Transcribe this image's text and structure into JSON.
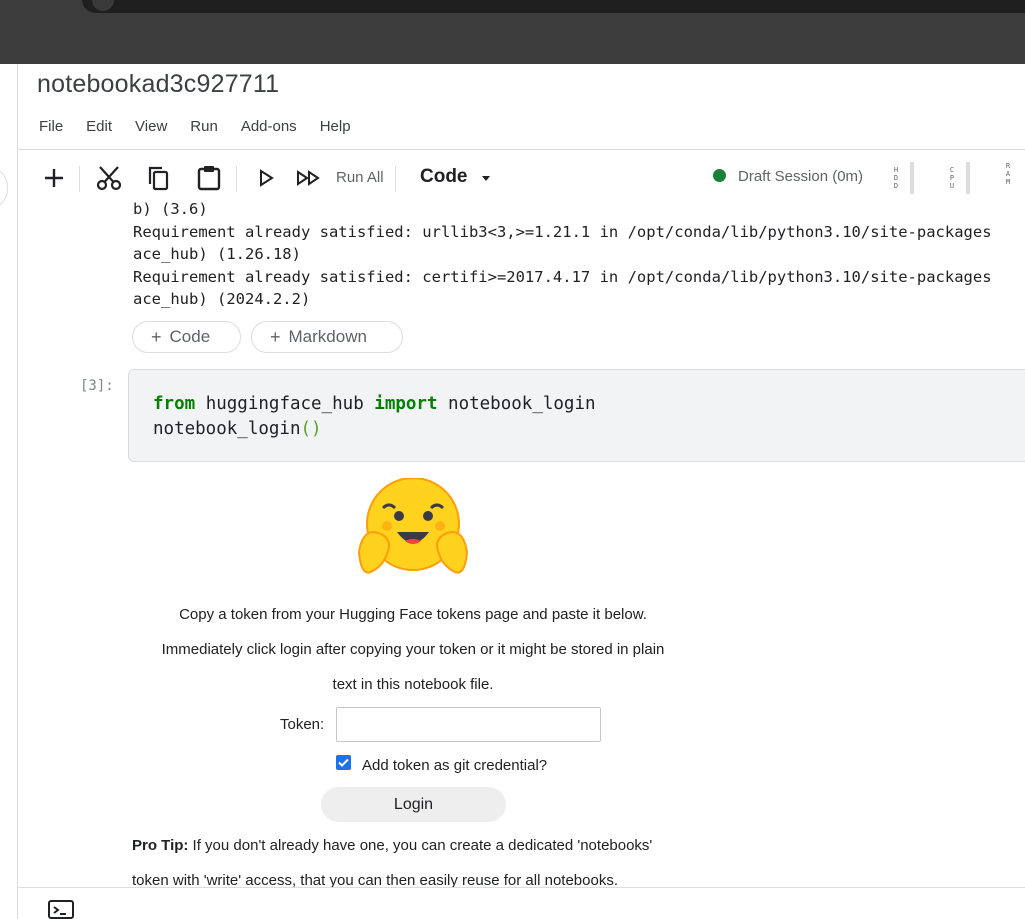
{
  "app": {
    "notebook_title": "notebookad3c927711"
  },
  "menu": {
    "items": [
      "File",
      "Edit",
      "View",
      "Run",
      "Add-ons",
      "Help"
    ]
  },
  "toolbar": {
    "run_all_label": "Run All",
    "cell_type": "Code",
    "session_status": "Draft Session (0m)",
    "session_color": "#188038",
    "meters": [
      "HDD",
      "CPU",
      "RAM"
    ],
    "icons": [
      "plus-icon",
      "cut-icon",
      "copy-icon",
      "paste-icon",
      "play-icon",
      "run-all-icon",
      "chevron-down-icon"
    ]
  },
  "output": {
    "lines": [
      "b) (3.6)",
      "Requirement already satisfied: urllib3<3,>=1.21.1 in /opt/conda/lib/python3.10/site-packages",
      "ace_hub) (1.26.18)",
      "Requirement already satisfied: certifi>=2017.4.17 in /opt/conda/lib/python3.10/site-packages",
      "ace_hub) (2024.2.2)"
    ]
  },
  "add_cell": {
    "code_label": "Code",
    "markdown_label": "Markdown"
  },
  "cell": {
    "prompt": "[3]:",
    "line1": {
      "kw1": "from",
      "mod": " huggingface_hub ",
      "kw2": "import",
      "name": " notebook_login"
    },
    "line2": {
      "fn": "notebook_login",
      "parens": "()"
    }
  },
  "login_widget": {
    "line1": "Copy a token from your Hugging Face tokens page and paste it below.",
    "line2": "Immediately click login after copying your token or it might be stored in plain",
    "line3": "text in this notebook file.",
    "token_label": "Token:",
    "token_value": "",
    "checkbox_label": "Add token as git credential?",
    "checkbox_checked": true,
    "login_button": "Login",
    "pro_tip_label": "Pro Tip:",
    "pro_tip_text": " If you don't already have one, you can create a dedicated 'notebooks'",
    "pro_tip_line2": "token with 'write' access, that you can then easily reuse for all notebooks."
  },
  "colors": {
    "accent": "#1a73e8",
    "keyword": "#008000"
  }
}
